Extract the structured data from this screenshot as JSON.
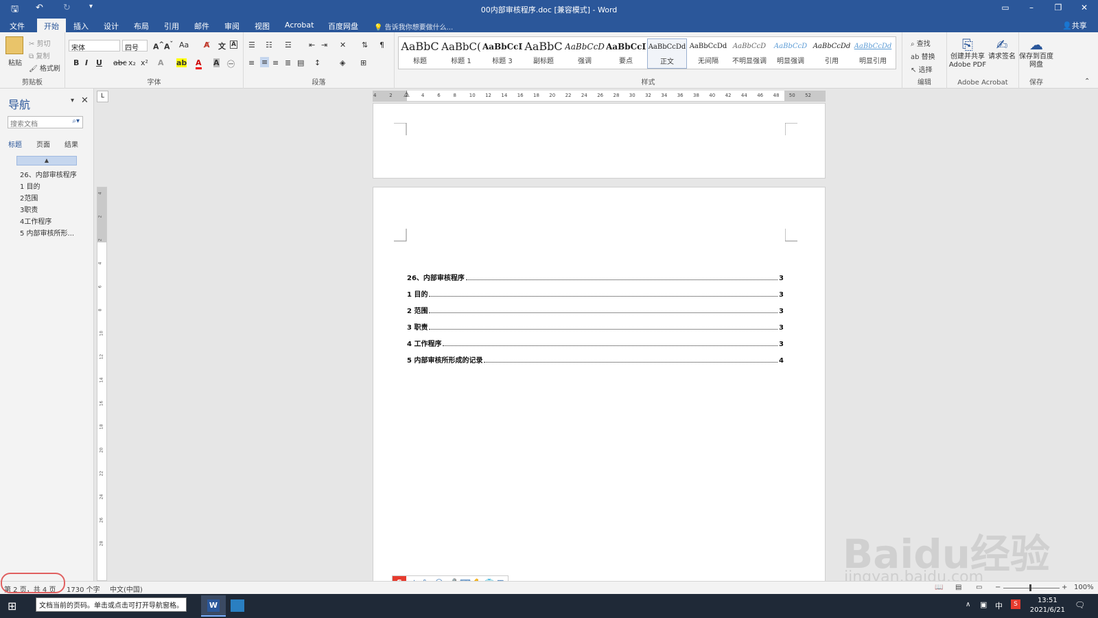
{
  "window": {
    "title": "00内部审核程序.doc [兼容模式] - Word"
  },
  "tabs": [
    {
      "label": "文件"
    },
    {
      "label": "开始",
      "active": true
    },
    {
      "label": "插入"
    },
    {
      "label": "设计"
    },
    {
      "label": "布局"
    },
    {
      "label": "引用"
    },
    {
      "label": "邮件"
    },
    {
      "label": "审阅"
    },
    {
      "label": "视图"
    },
    {
      "label": "Acrobat"
    },
    {
      "label": "百度网盘"
    }
  ],
  "tell_me": "告诉我你想要做什么...",
  "share_label": "共享",
  "ribbon": {
    "clipboard": {
      "paste": "粘贴",
      "cut": "剪切",
      "copy": "复制",
      "format_painter": "格式刷",
      "group": "剪贴板"
    },
    "font": {
      "font_name": "宋体",
      "font_size": "四号",
      "group": "字体"
    },
    "paragraph": {
      "group": "段落"
    },
    "styles": {
      "group": "样式",
      "items": [
        {
          "preview": "AaBbC",
          "name": "标题"
        },
        {
          "preview": "AaBbC(",
          "name": "标题 1"
        },
        {
          "preview": "AaBbCcD(",
          "name": "标题 3"
        },
        {
          "preview": "AaBbC",
          "name": "副标题"
        },
        {
          "preview": "AaBbCcD",
          "name": "强调"
        },
        {
          "preview": "AaBbCcD",
          "name": "要点"
        },
        {
          "preview": "AaBbCcDd",
          "name": "正文",
          "selected": true
        },
        {
          "preview": "AaBbCcDd",
          "name": "无间隔"
        },
        {
          "preview": "AaBbCcD",
          "name": "不明显强调"
        },
        {
          "preview": "AaBbCcD",
          "name": "明显强调"
        },
        {
          "preview": "AaBbCcDd",
          "name": "引用"
        },
        {
          "preview": "AaBbCcDd",
          "name": "明显引用"
        }
      ]
    },
    "editing": {
      "find": "查找",
      "replace": "替换",
      "select": "选择",
      "group": "编辑"
    },
    "acrobat": {
      "create_share": "创建并共享 Adobe PDF",
      "request_sign": "请求签名",
      "group": "Adobe Acrobat"
    },
    "save": {
      "save_to": "保存到百度网盘",
      "group": "保存"
    }
  },
  "navigation": {
    "title": "导航",
    "search_placeholder": "搜索文档",
    "tabs": [
      {
        "label": "标题",
        "active": true
      },
      {
        "label": "页面"
      },
      {
        "label": "结果"
      }
    ],
    "items": [
      "26、内部审核程序",
      "1 目的",
      "2范围",
      "3职责",
      "4工作程序",
      "5 内部审核所形..."
    ]
  },
  "ruler": {
    "ticks": [
      "4",
      "2",
      "2",
      "4",
      "6",
      "8",
      "10",
      "12",
      "14",
      "16",
      "18",
      "20",
      "22",
      "24",
      "26",
      "28",
      "30",
      "32",
      "34",
      "36",
      "38",
      "40",
      "42",
      "44",
      "46",
      "48",
      "50",
      "52"
    ],
    "vticks": [
      "4",
      "2",
      "2",
      "4",
      "6",
      "8",
      "10",
      "12",
      "14",
      "16",
      "18",
      "20",
      "22",
      "24",
      "26",
      "28"
    ]
  },
  "toc": [
    {
      "label": "26、内部审核程序",
      "page": "3"
    },
    {
      "label": "1 目的",
      "page": "3"
    },
    {
      "label": "2 范围",
      "page": "3"
    },
    {
      "label": "3 职责",
      "page": "3"
    },
    {
      "label": "4 工作程序",
      "page": "3"
    },
    {
      "label": "5 内部审核所形成的记录",
      "page": "4"
    }
  ],
  "status_bar": {
    "page_info": "第 2 页，共 4 页",
    "word_count": "1730 个字",
    "language": "中文(中国)",
    "zoom": "100%"
  },
  "tooltip": "文档当前的页码。单击或点击可打开导航窗格。",
  "taskbar": {
    "time": "13:51",
    "date": "2021/6/21",
    "ime_lang": "中"
  },
  "ime_toolbar": {
    "mode": "中"
  },
  "watermark": {
    "text": "Baidu经验",
    "url": "jingyan.baidu.com"
  }
}
